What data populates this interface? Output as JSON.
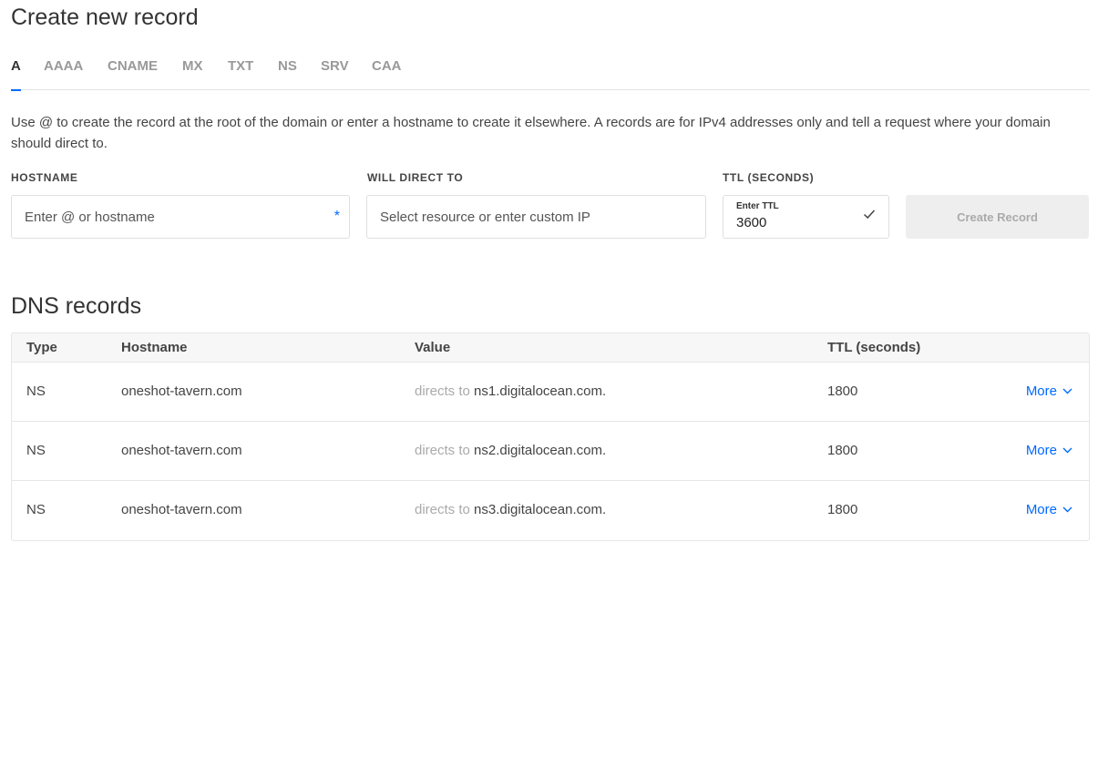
{
  "page_title": "Create new record",
  "tabs": [
    {
      "label": "A",
      "active": true
    },
    {
      "label": "AAAA"
    },
    {
      "label": "CNAME"
    },
    {
      "label": "MX"
    },
    {
      "label": "TXT"
    },
    {
      "label": "NS"
    },
    {
      "label": "SRV"
    },
    {
      "label": "CAA"
    }
  ],
  "help_text": "Use @ to create the record at the root of the domain or enter a hostname to create it elsewhere. A records are for IPv4 addresses only and tell a request where your domain should direct to.",
  "form": {
    "hostname_label": "HOSTNAME",
    "hostname_placeholder": "Enter @ or hostname",
    "required_mark": "*",
    "direct_label": "WILL DIRECT TO",
    "direct_placeholder": "Select resource or enter custom IP",
    "ttl_label": "TTL (SECONDS)",
    "ttl_inner_label": "Enter TTL",
    "ttl_value": "3600",
    "create_button": "Create Record"
  },
  "records": {
    "title": "DNS records",
    "columns": [
      "Type",
      "Hostname",
      "Value",
      "TTL (seconds)"
    ],
    "rows": [
      {
        "type": "NS",
        "hostname": "oneshot-tavern.com",
        "prefix": "directs to",
        "value": "ns1.digitalocean.com.",
        "ttl": "1800",
        "more": "More"
      },
      {
        "type": "NS",
        "hostname": "oneshot-tavern.com",
        "prefix": "directs to",
        "value": "ns2.digitalocean.com.",
        "ttl": "1800",
        "more": "More"
      },
      {
        "type": "NS",
        "hostname": "oneshot-tavern.com",
        "prefix": "directs to",
        "value": "ns3.digitalocean.com.",
        "ttl": "1800",
        "more": "More"
      }
    ]
  },
  "colors": {
    "accent": "#0069ff",
    "disabled_button_bg": "#eeeeee"
  },
  "icons": {
    "ttl_confirm": "check-icon",
    "more_menu": "chevron-down-icon"
  }
}
